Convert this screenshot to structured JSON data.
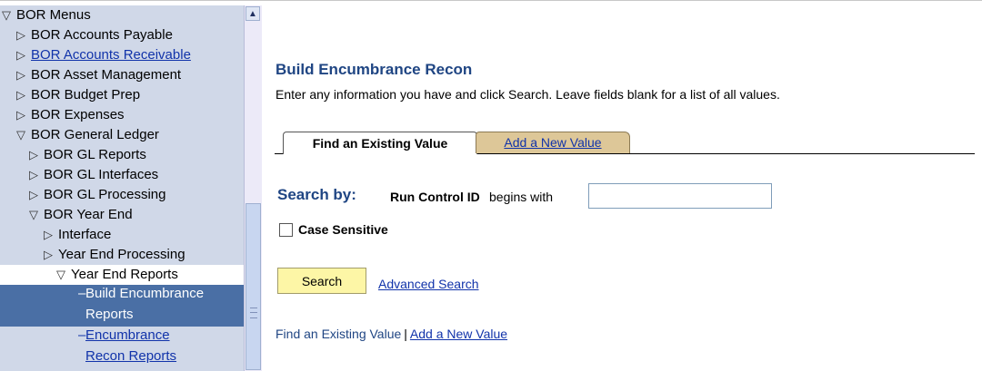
{
  "nav": {
    "items": [
      {
        "label": "BOR Menus",
        "indicator": "▽",
        "level": 0,
        "state": "normal"
      },
      {
        "label": "BOR Accounts Payable",
        "indicator": "▷",
        "level": 1,
        "state": "normal"
      },
      {
        "label": "BOR Accounts Receivable",
        "indicator": "▷",
        "level": 1,
        "state": "link"
      },
      {
        "label": "BOR Asset Management",
        "indicator": "▷",
        "level": 1,
        "state": "normal"
      },
      {
        "label": "BOR Budget Prep",
        "indicator": "▷",
        "level": 1,
        "state": "normal"
      },
      {
        "label": "BOR Expenses",
        "indicator": "▷",
        "level": 1,
        "state": "normal"
      },
      {
        "label": "BOR General Ledger",
        "indicator": "▽",
        "level": 1,
        "state": "normal"
      },
      {
        "label": "BOR GL Reports",
        "indicator": "▷",
        "level": 2,
        "state": "normal"
      },
      {
        "label": "BOR GL Interfaces",
        "indicator": "▷",
        "level": 2,
        "state": "normal"
      },
      {
        "label": "BOR GL Processing",
        "indicator": "▷",
        "level": 2,
        "state": "normal"
      },
      {
        "label": "BOR Year End",
        "indicator": "▽",
        "level": 2,
        "state": "normal"
      },
      {
        "label": "Interface",
        "indicator": "▷",
        "level": 3,
        "state": "normal"
      },
      {
        "label": "Year End Processing",
        "indicator": "▷",
        "level": 3,
        "state": "normal"
      },
      {
        "label": "Year End Reports",
        "indicator": "▽",
        "level": 4,
        "state": "current"
      }
    ],
    "sub_items": [
      {
        "line1": "Build Encumbrance",
        "line2": "Reports",
        "indicator": "–",
        "state": "selected"
      },
      {
        "line1": "Encumbrance",
        "line2": "Recon Reports",
        "indicator": "–",
        "state": "link"
      }
    ]
  },
  "scrollbar": {
    "up_arrow": "▲",
    "thumb_position": 0.55
  },
  "main": {
    "title": "Build Encumbrance Recon",
    "instructions": "Enter any information you have and click Search. Leave fields blank for a list of all values.",
    "tabs": [
      {
        "label": "Find an Existing Value",
        "active": true
      },
      {
        "label": "Add a New Value",
        "active": false
      }
    ],
    "search_by_label": "Search by:",
    "field_label": "Run Control ID",
    "operator_label": "begins with",
    "field_value": "",
    "case_sensitive_label": "Case Sensitive",
    "case_sensitive_checked": false,
    "search_button": "Search",
    "advanced_search_link": "Advanced Search",
    "bottom_links": {
      "find": "Find an Existing Value",
      "separator": "|",
      "add": "Add a New Value"
    }
  },
  "colors": {
    "nav_bg": "#d0d8e8",
    "selected_bg": "#4a6fa5",
    "title_color": "#1f4583",
    "link_color": "#1133aa",
    "search_button_bg": "#fdf6a6",
    "inactive_tab_bg": "#ddc798"
  }
}
